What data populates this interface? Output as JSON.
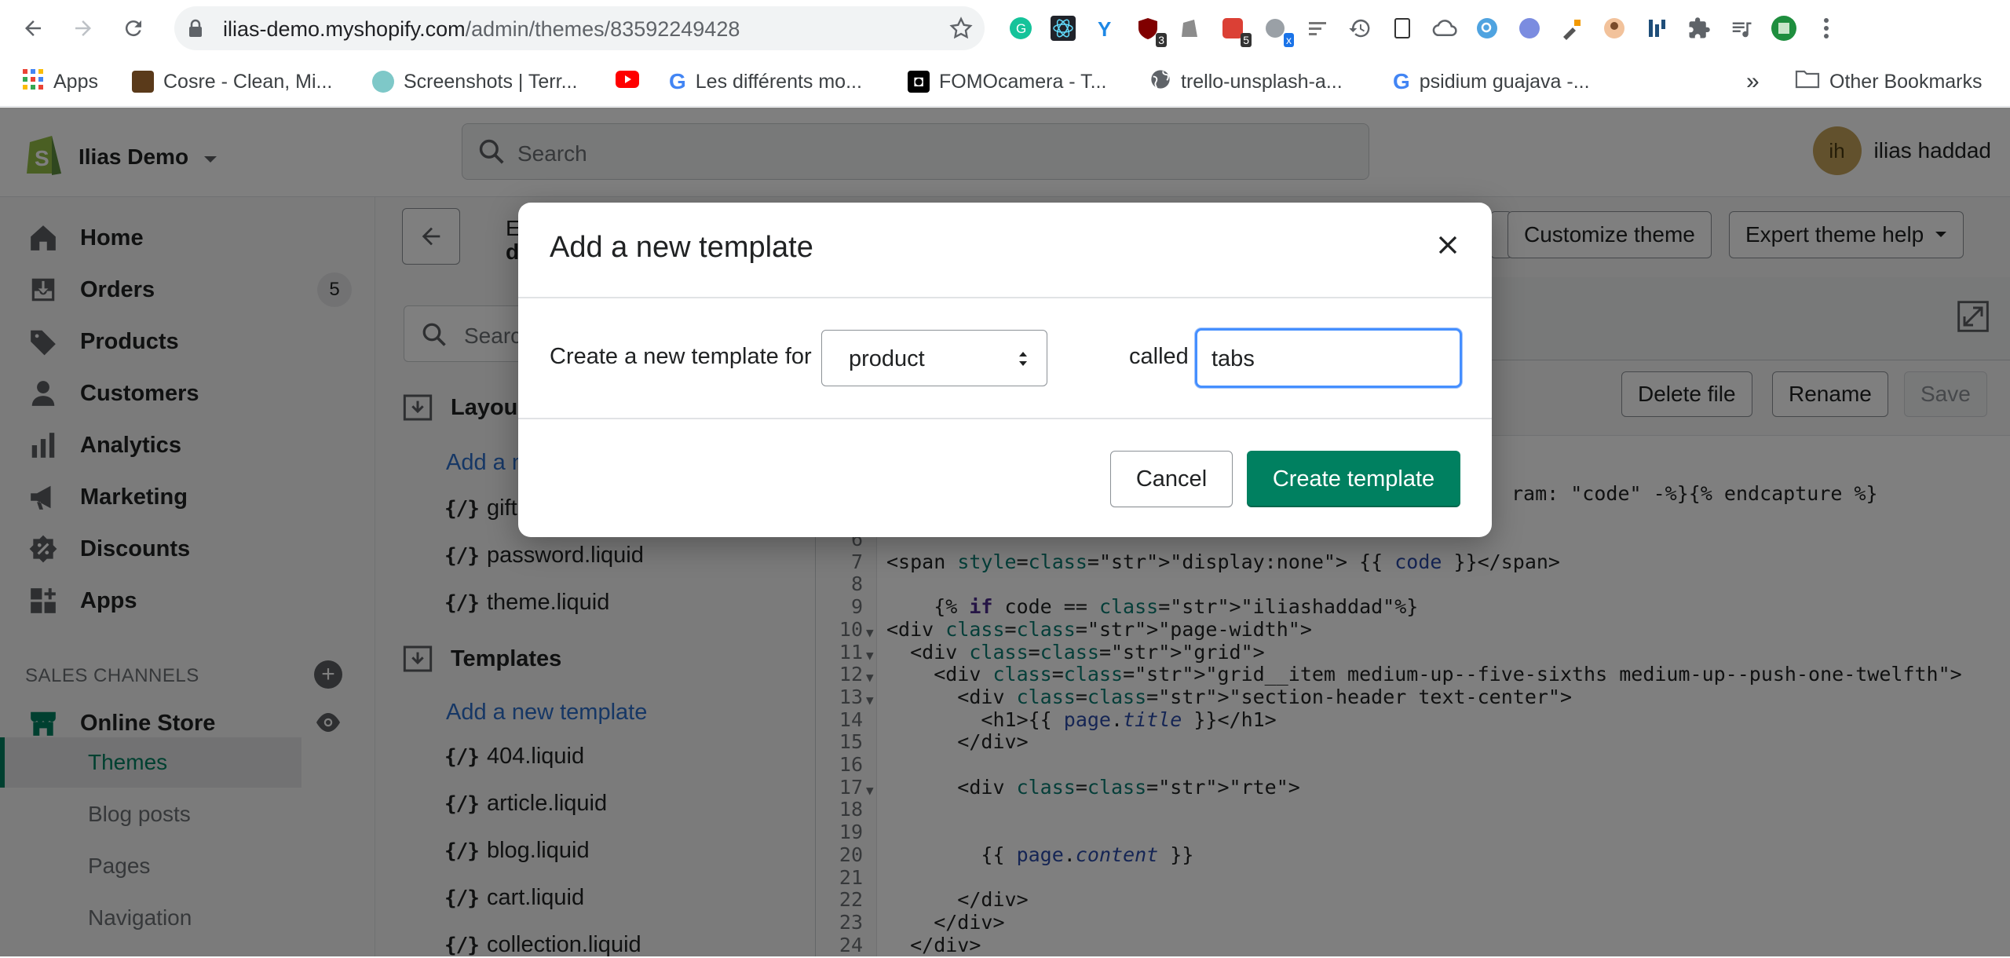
{
  "browser": {
    "url_host": "ilias-demo.myshopify.com",
    "url_path": "/admin/themes/83592249428",
    "ext_badges": {
      "ext1": "3",
      "ext2": "5",
      "ext3": "x"
    },
    "bookmarks": [
      {
        "label": "Apps"
      },
      {
        "label": "Cosre - Clean, Mi..."
      },
      {
        "label": "Screenshots | Terr..."
      },
      {
        "label": ""
      },
      {
        "label": "Les différents mo..."
      },
      {
        "label": "FOMOcamera - T..."
      },
      {
        "label": "trello-unsplash-a..."
      },
      {
        "label": "psidium guajava -..."
      }
    ],
    "more": "»",
    "other_bookmarks": "Other Bookmarks"
  },
  "topbar": {
    "store_name": "Ilias Demo",
    "search_placeholder": "Search",
    "avatar_initials": "ih",
    "user_name": "ilias haddad"
  },
  "sidebar": {
    "items": [
      {
        "label": "Home"
      },
      {
        "label": "Orders",
        "count": "5"
      },
      {
        "label": "Products"
      },
      {
        "label": "Customers"
      },
      {
        "label": "Analytics"
      },
      {
        "label": "Marketing"
      },
      {
        "label": "Discounts"
      },
      {
        "label": "Apps"
      }
    ],
    "sales_channels_label": "SALES CHANNELS",
    "online_store": "Online Store",
    "sub_items": [
      "Themes",
      "Blog posts",
      "Pages",
      "Navigation"
    ]
  },
  "main": {
    "title_partial": "E",
    "title_partial2": "d",
    "customize_theme": "Customize theme",
    "expert_help": "Expert theme help",
    "file_search_placeholder": "Searc",
    "layout_heading": "Layou",
    "layout_add": "Add a n",
    "layout_files": [
      "gift",
      "password.liquid",
      "theme.liquid"
    ],
    "templates_heading": "Templates",
    "templates_add": "Add a new template",
    "template_files": [
      "404.liquid",
      "article.liquid",
      "blog.liquid",
      "cart.liquid",
      "collection.liquid"
    ],
    "delete_file": "Delete file",
    "rename": "Rename",
    "save": "Save"
  },
  "code": {
    "line5_tail": "ram: \"code\" -%}{% endcapture %}",
    "lines": [
      {
        "n": "6",
        "text": ""
      },
      {
        "n": "7",
        "text": "<span style=\"display:none\"> {{ code }}</span>"
      },
      {
        "n": "8",
        "text": ""
      },
      {
        "n": "9",
        "text": "    {% if code == \"iliashaddad\"%}"
      },
      {
        "n": "10",
        "text": "<div class=\"page-width\">"
      },
      {
        "n": "11",
        "text": "  <div class=\"grid\">"
      },
      {
        "n": "12",
        "text": "    <div class=\"grid__item medium-up--five-sixths medium-up--push-one-twelfth\">"
      },
      {
        "n": "13",
        "text": "      <div class=\"section-header text-center\">"
      },
      {
        "n": "14",
        "text": "        <h1>{{ page.title }}</h1>"
      },
      {
        "n": "15",
        "text": "      </div>"
      },
      {
        "n": "16",
        "text": ""
      },
      {
        "n": "17",
        "text": "      <div class=\"rte\">"
      },
      {
        "n": "18",
        "text": ""
      },
      {
        "n": "19",
        "text": ""
      },
      {
        "n": "20",
        "text": "        {{ page.content }}"
      },
      {
        "n": "21",
        "text": ""
      },
      {
        "n": "22",
        "text": "      </div>"
      },
      {
        "n": "23",
        "text": "    </div>"
      },
      {
        "n": "24",
        "text": "  </div>"
      }
    ]
  },
  "modal": {
    "title": "Add a new template",
    "label_for": "Create a new template for",
    "selected_type": "product",
    "label_called": "called",
    "name_value": "tabs",
    "cancel": "Cancel",
    "create": "Create template"
  },
  "colors": {
    "primary": "#008060",
    "link": "#2c6ecb",
    "focus": "#458fff"
  }
}
